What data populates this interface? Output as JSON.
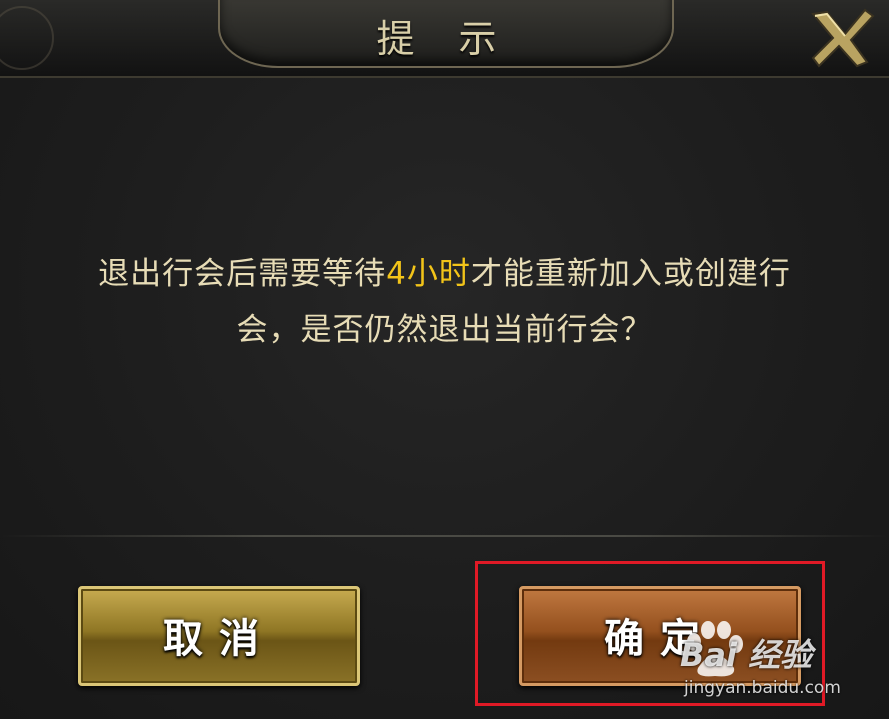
{
  "dialog": {
    "title": "提 示",
    "message_line1_before": "退出行会后需要等待",
    "message_line1_highlight": "4小时",
    "message_line1_after": "才能重新加入或创建行",
    "message_line2": "会，是否仍然退出当前行会？"
  },
  "buttons": {
    "cancel_label": "取消",
    "confirm_label": "确定"
  },
  "watermark": {
    "brand": "Bai  经验",
    "url": "jingyan.baidu.com"
  },
  "icons": {
    "close": "close-icon",
    "watermark": "baidu-paw-icon"
  },
  "colors": {
    "text": "#e7dcb6",
    "highlight": "#f2c419",
    "annotation": "#e01a26"
  }
}
